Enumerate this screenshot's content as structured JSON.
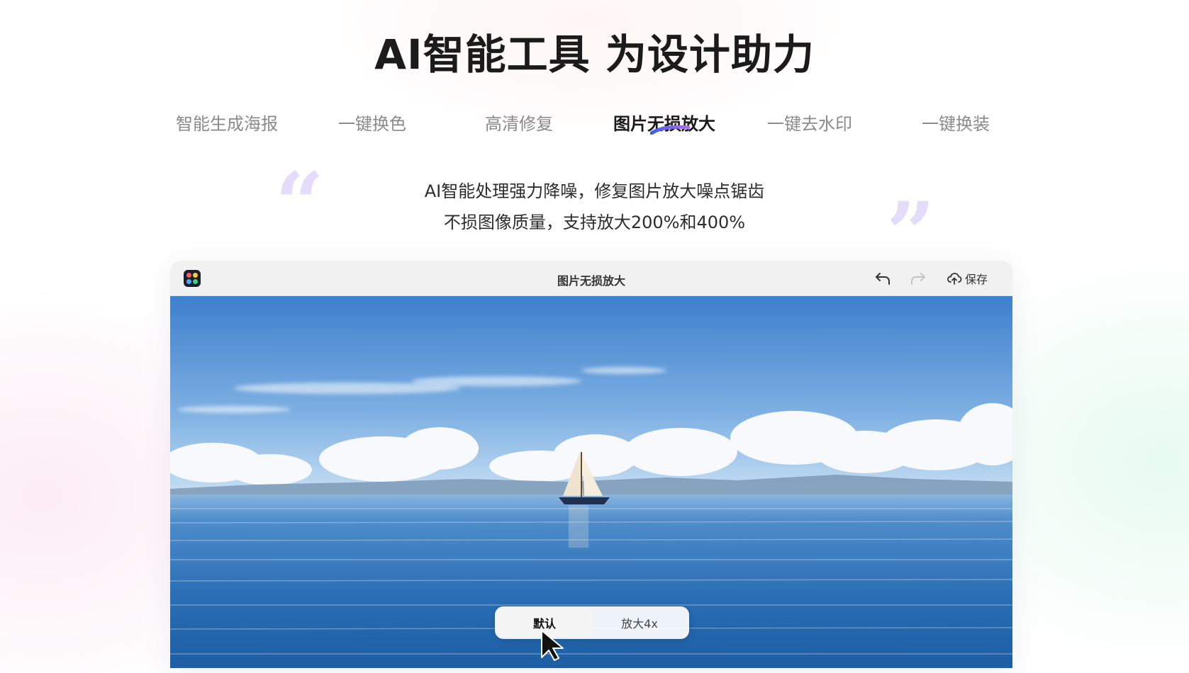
{
  "headline": "AI智能工具 为设计助力",
  "tabs": [
    {
      "label": "智能生成海报",
      "active": false
    },
    {
      "label": "一键换色",
      "active": false
    },
    {
      "label": "高清修复",
      "active": false
    },
    {
      "label": "图片无损放大",
      "active": true
    },
    {
      "label": "一键去水印",
      "active": false
    },
    {
      "label": "一键换装",
      "active": false
    }
  ],
  "description": {
    "line1": "AI智能处理强力降噪，修复图片放大噪点锯齿",
    "line2": "不损图像质量，支持放大200%和400%"
  },
  "window": {
    "title": "图片无损放大",
    "save_label": "保存",
    "toggle": {
      "options": [
        {
          "label": "默认",
          "active": true
        },
        {
          "label": "放大4x",
          "active": false
        }
      ]
    }
  },
  "icons": {
    "app_logo": "app-logo-icon",
    "undo": "undo-icon",
    "redo": "redo-icon",
    "save": "cloud-save-icon",
    "cursor": "mouse-pointer-icon"
  },
  "colors": {
    "accent_underline": "#6d4cf5",
    "quote_mark": "#e3dcfb",
    "sky_top": "#3f82cf",
    "sea": "#2a6fb5"
  }
}
